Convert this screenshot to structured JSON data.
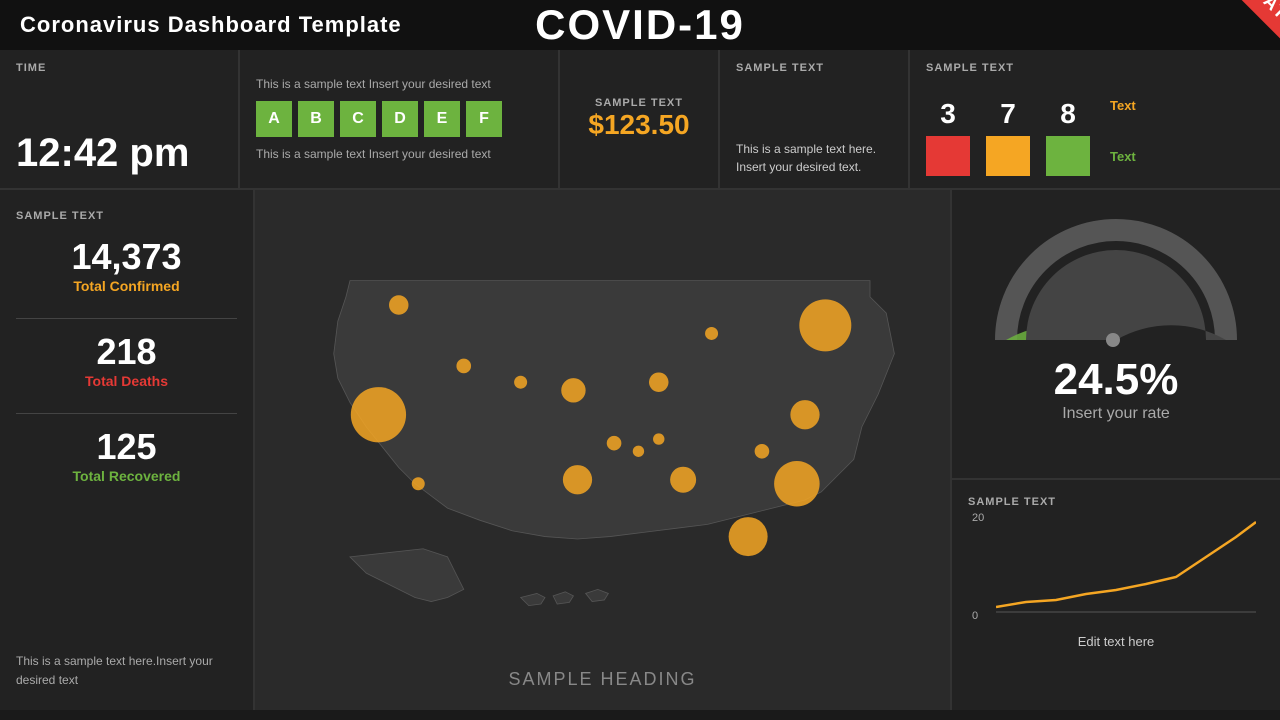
{
  "header": {
    "title": "Coronavirus Dashboard Template",
    "covid_label": "COVID-19",
    "dummy_banner": "DUMMY DATA"
  },
  "top_row": {
    "time_label": "TIME",
    "time_value": "12:42 pm",
    "buttons_label": "SAMPLE TEXT",
    "buttons_top_text": "This is a sample text Insert your desired text",
    "buttons_bottom_text": "This is a sample text Insert your desired text",
    "buttons": [
      "A",
      "B",
      "C",
      "D",
      "E",
      "F"
    ],
    "price_label": "SAMPLE TEXT",
    "price_value": "$123.50",
    "sample_label": "SAMPLE TEXT",
    "sample_body": "This is a sample text here. Insert your desired text.",
    "numbers_label": "SAMPLE TEXT",
    "numbers": [
      {
        "value": "3",
        "color": "#e53935"
      },
      {
        "value": "7",
        "color": "#f5a623"
      },
      {
        "value": "8",
        "color": "#6db33f"
      }
    ],
    "text_right_orange": "Text",
    "text_right_green": "Text"
  },
  "left_panel": {
    "label": "SAMPLE TEXT",
    "stat1_value": "14,373",
    "stat1_label": "Total Confirmed",
    "stat2_value": "218",
    "stat2_label": "Total Deaths",
    "stat3_value": "125",
    "stat3_label": "Total Recovered",
    "bottom_text": "This is a sample text here.Insert your desired text"
  },
  "map_panel": {
    "heading": "SAMPLE HEADING"
  },
  "gauge": {
    "percent_value": "24.5%",
    "label": "Insert your rate",
    "percent_number": 24.5
  },
  "chart": {
    "label": "SAMPLE TEXT",
    "y_max": "20",
    "y_min": "0",
    "edit_label": "Edit text here"
  }
}
